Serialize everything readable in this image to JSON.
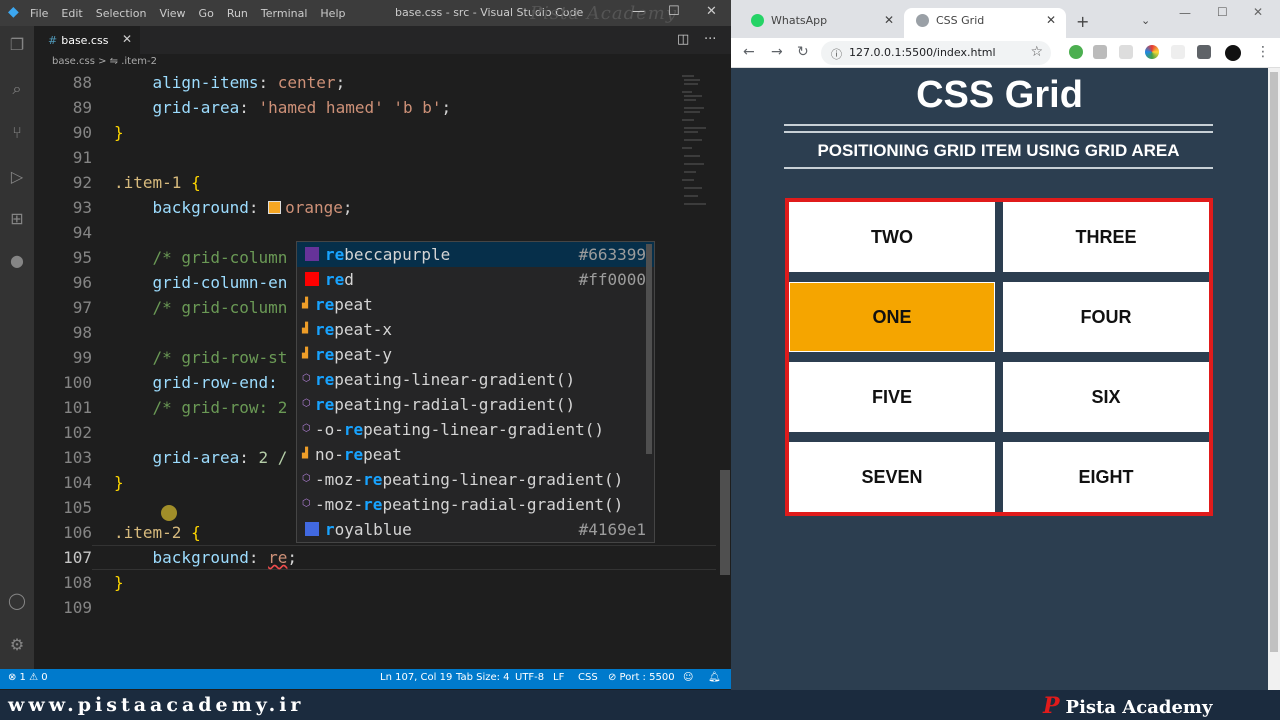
{
  "vscode": {
    "menu": [
      "File",
      "Edit",
      "Selection",
      "View",
      "Go",
      "Run",
      "Terminal",
      "Help"
    ],
    "title": "base.css - src - Visual Studio Code",
    "watermark": "Pista Academy",
    "tab_label": "base.css",
    "breadcrumb": "base.css > ⇋ .item-2",
    "line_numbers": [
      "88",
      "89",
      "90",
      "91",
      "92",
      "93",
      "94",
      "95",
      "96",
      "97",
      "98",
      "99",
      "100",
      "101",
      "102",
      "103",
      "104",
      "105",
      "106",
      "107",
      "108",
      "109"
    ],
    "code": {
      "l88_prop": "align-items",
      "l88_val": "center",
      "l89_prop": "grid-area",
      "l89_val": "'hamed hamed' 'b b'",
      "l92_sel": ".item-1",
      "l93_prop": "background",
      "l93_val": "orange",
      "l95": "/* grid-column",
      "l96": "grid-column-en",
      "l97": "/* grid-column",
      "l99": "/* grid-row-st",
      "l100": "grid-row-end:",
      "l101": "/* grid-row: 2",
      "l103_prop": "grid-area",
      "l103_val": "2 /",
      "l106_sel": ".item-2",
      "l107_prop": "background",
      "l107_val": "re"
    },
    "suggestions": [
      {
        "match": "re",
        "rest": "beccapurple",
        "hex": "#663399",
        "color": "#663399",
        "kind": "color"
      },
      {
        "match": "re",
        "rest": "d",
        "hex": "#ff0000",
        "color": "#ff0000",
        "kind": "color"
      },
      {
        "pre": "",
        "match": "re",
        "rest": "peat",
        "kind": "value"
      },
      {
        "pre": "",
        "match": "re",
        "rest": "peat-x",
        "kind": "value"
      },
      {
        "pre": "",
        "match": "re",
        "rest": "peat-y",
        "kind": "value"
      },
      {
        "pre": "",
        "match": "re",
        "rest": "peating-linear-gradient()",
        "kind": "function"
      },
      {
        "pre": "",
        "match": "re",
        "rest": "peating-radial-gradient()",
        "kind": "function"
      },
      {
        "pre": "-o-",
        "match": "re",
        "rest": "peating-linear-gradient()",
        "kind": "function"
      },
      {
        "pre": "no-",
        "match": "re",
        "rest": "peat",
        "kind": "value"
      },
      {
        "pre": "-moz-",
        "match": "re",
        "rest": "peating-linear-gradient()",
        "kind": "function"
      },
      {
        "pre": "-moz-",
        "match": "re",
        "rest": "peating-radial-gradient()",
        "kind": "function"
      },
      {
        "match": "r",
        "rest": "oyalblue",
        "hex": "#4169e1",
        "color": "#4169e1",
        "kind": "color"
      }
    ],
    "status": {
      "problems": "⊗ 1 ⚠ 0",
      "position": "Ln 107, Col 19",
      "tab_size": "Tab Size: 4",
      "encoding": "UTF-8",
      "eol": "LF",
      "language": "CSS",
      "port": "⊘ Port : 5500"
    }
  },
  "browser": {
    "tabs": [
      {
        "label": "WhatsApp"
      },
      {
        "label": "CSS Grid"
      }
    ],
    "url": "127.0.0.1:5500/index.html",
    "page": {
      "heading": "CSS Grid",
      "subtitle": "POSITIONING GRID ITEM USING GRID AREA",
      "cells": [
        "TWO",
        "THREE",
        "ONE",
        "FOUR",
        "FIVE",
        "SIX",
        "SEVEN",
        "EIGHT"
      ]
    }
  },
  "footer": {
    "site": "www.pistaacademy.ir",
    "brand": "Pista Academy",
    "brand_logo": "P"
  },
  "colors": {
    "accent": "#007acc",
    "orange": "#f5a500",
    "grid_border": "#e01b1b",
    "page_bg": "#2c3e50"
  }
}
